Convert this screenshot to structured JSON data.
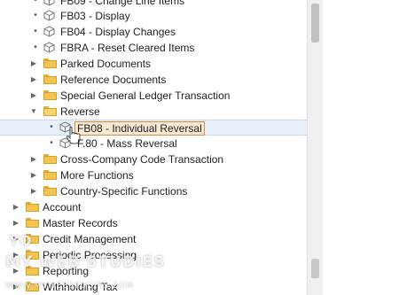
{
  "tree": {
    "items": [
      {
        "label": "FB09 - Change Line Items",
        "kind": "transaction"
      },
      {
        "label": "FB03 - Display",
        "kind": "transaction"
      },
      {
        "label": "FB04 - Display Changes",
        "kind": "transaction"
      },
      {
        "label": "FBRA - Reset Cleared Items",
        "kind": "transaction"
      },
      {
        "label": "Parked Documents",
        "kind": "folder",
        "state": "collapsed"
      },
      {
        "label": "Reference Documents",
        "kind": "folder",
        "state": "collapsed"
      },
      {
        "label": "Special General Ledger Transaction",
        "kind": "folder",
        "state": "collapsed"
      },
      {
        "label": "Reverse",
        "kind": "folder",
        "state": "expanded"
      },
      {
        "label": "FB08 - Individual Reversal",
        "kind": "transaction",
        "selected": true
      },
      {
        "label": "F.80 - Mass Reversal",
        "kind": "transaction"
      },
      {
        "label": "Cross-Company Code Transaction",
        "kind": "folder",
        "state": "collapsed"
      },
      {
        "label": "More Functions",
        "kind": "folder",
        "state": "collapsed"
      },
      {
        "label": "Country-Specific Functions",
        "kind": "folder",
        "state": "collapsed"
      },
      {
        "label": "Account",
        "kind": "folder",
        "state": "collapsed"
      },
      {
        "label": "Master Records",
        "kind": "folder",
        "state": "collapsed"
      },
      {
        "label": "Credit Management",
        "kind": "folder",
        "state": "collapsed"
      },
      {
        "label": "Periodic Processing",
        "kind": "folder",
        "state": "collapsed"
      },
      {
        "label": "Reporting",
        "kind": "folder",
        "state": "collapsed"
      },
      {
        "label": "Withholding Tax",
        "kind": "folder",
        "state": "collapsed"
      }
    ]
  },
  "watermark": {
    "line1": "YO",
    "line2": "MY WEB STUDIES",
    "line3": "WWW.MYWEBSTUDIES.COM"
  },
  "colors": {
    "folder": "#f3c44f",
    "selection_border": "#e08a3c",
    "selection_fill": "#fbe9d4"
  }
}
